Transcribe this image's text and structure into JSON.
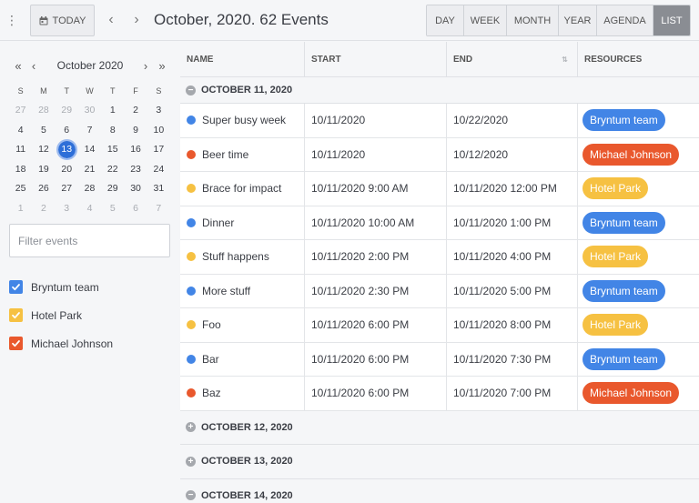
{
  "toolbar": {
    "today_label": "TODAY",
    "title": "October, 2020. 62 Events",
    "modes": [
      {
        "label": "DAY",
        "active": false
      },
      {
        "label": "WEEK",
        "active": false
      },
      {
        "label": "MONTH",
        "active": false
      },
      {
        "label": "YEAR",
        "active": false
      },
      {
        "label": "AGENDA",
        "active": false
      },
      {
        "label": "LIST",
        "active": true
      }
    ]
  },
  "calendar": {
    "month_label": "October 2020",
    "weekdays": [
      "S",
      "M",
      "T",
      "W",
      "T",
      "F",
      "S"
    ],
    "weeks": [
      [
        "27",
        "28",
        "29",
        "30",
        "1",
        "2",
        "3"
      ],
      [
        "4",
        "5",
        "6",
        "7",
        "8",
        "9",
        "10"
      ],
      [
        "11",
        "12",
        "13",
        "14",
        "15",
        "16",
        "17"
      ],
      [
        "18",
        "19",
        "20",
        "21",
        "22",
        "23",
        "24"
      ],
      [
        "25",
        "26",
        "27",
        "28",
        "29",
        "30",
        "31"
      ],
      [
        "1",
        "2",
        "3",
        "4",
        "5",
        "6",
        "7"
      ]
    ],
    "selected_day": "13"
  },
  "filter": {
    "placeholder": "Filter events",
    "value": ""
  },
  "resources": [
    {
      "name": "Bryntum team",
      "color": "#4285e6",
      "checked": true
    },
    {
      "name": "Hotel Park",
      "color": "#f6c142",
      "checked": true
    },
    {
      "name": "Michael Johnson",
      "color": "#e9582d",
      "checked": true
    }
  ],
  "columns": {
    "name": "NAME",
    "start": "START",
    "end": "END",
    "resources": "RESOURCES"
  },
  "groups": [
    {
      "label": "OCTOBER 11, 2020",
      "expanded": true,
      "events": [
        {
          "name": "Super busy week",
          "start": "10/11/2020",
          "end": "10/22/2020",
          "resource": "Bryntum team",
          "color": "#4285e6"
        },
        {
          "name": "Beer time",
          "start": "10/11/2020",
          "end": "10/12/2020",
          "resource": "Michael Johnson",
          "color": "#e9582d"
        },
        {
          "name": "Brace for impact",
          "start": "10/11/2020 9:00 AM",
          "end": "10/11/2020 12:00 PM",
          "resource": "Hotel Park",
          "color": "#f6c142"
        },
        {
          "name": "Dinner",
          "start": "10/11/2020 10:00 AM",
          "end": "10/11/2020 1:00 PM",
          "resource": "Bryntum team",
          "color": "#4285e6"
        },
        {
          "name": "Stuff happens",
          "start": "10/11/2020 2:00 PM",
          "end": "10/11/2020 4:00 PM",
          "resource": "Hotel Park",
          "color": "#f6c142"
        },
        {
          "name": "More stuff",
          "start": "10/11/2020 2:30 PM",
          "end": "10/11/2020 5:00 PM",
          "resource": "Bryntum team",
          "color": "#4285e6"
        },
        {
          "name": "Foo",
          "start": "10/11/2020 6:00 PM",
          "end": "10/11/2020 8:00 PM",
          "resource": "Hotel Park",
          "color": "#f6c142"
        },
        {
          "name": "Bar",
          "start": "10/11/2020 6:00 PM",
          "end": "10/11/2020 7:30 PM",
          "resource": "Bryntum team",
          "color": "#4285e6"
        },
        {
          "name": "Baz",
          "start": "10/11/2020 6:00 PM",
          "end": "10/11/2020 7:00 PM",
          "resource": "Michael Johnson",
          "color": "#e9582d"
        }
      ]
    },
    {
      "label": "OCTOBER 12, 2020",
      "expanded": false,
      "events": []
    },
    {
      "label": "OCTOBER 13, 2020",
      "expanded": false,
      "events": []
    },
    {
      "label": "OCTOBER 14, 2020",
      "expanded": true,
      "events": []
    }
  ]
}
